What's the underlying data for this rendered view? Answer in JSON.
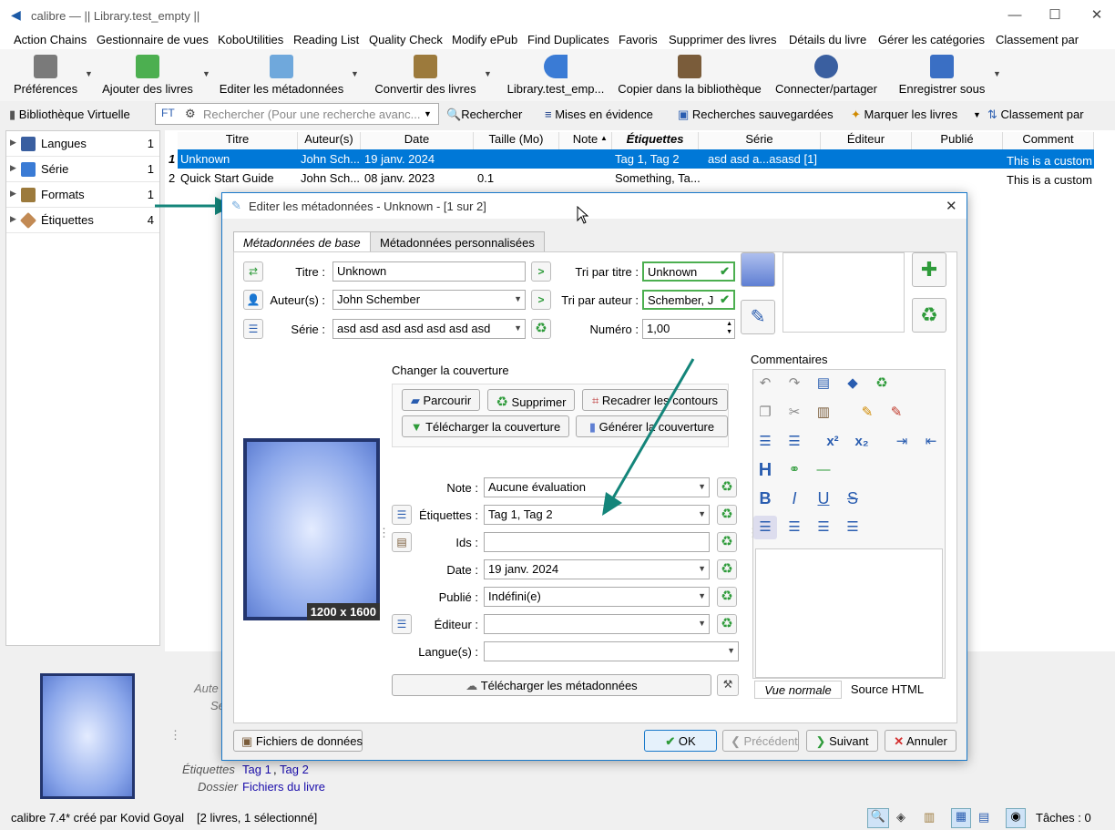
{
  "window": {
    "title": "calibre — || Library.test_empty ||"
  },
  "menu": [
    "Action Chains",
    "Gestionnaire de vues",
    "KoboUtilities",
    "Reading List",
    "Quality Check",
    "Modify ePub",
    "Find Duplicates",
    "Favoris",
    "Supprimer des livres",
    "Détails du livre",
    "Gérer les catégories",
    "Classement par"
  ],
  "toolbar": {
    "prefs": "Préférences",
    "add": "Ajouter des livres",
    "edit": "Editer les métadonnées",
    "convert": "Convertir des livres",
    "library": "Library.test_emp...",
    "copy": "Copier dans la bibliothèque",
    "connect": "Connecter/partager",
    "save": "Enregistrer sous"
  },
  "searchbar": {
    "virtual": "Bibliothèque Virtuelle",
    "placeholder": "Rechercher (Pour une recherche avanc...",
    "search": "Rechercher",
    "highlight": "Mises en évidence",
    "saved": "Recherches sauvegardées",
    "mark": "Marquer les livres",
    "sort": "Classement par"
  },
  "tagbrowser": [
    {
      "name": "Langues",
      "count": "1"
    },
    {
      "name": "Série",
      "count": "1"
    },
    {
      "name": "Formats",
      "count": "1"
    },
    {
      "name": "Étiquettes",
      "count": "4"
    }
  ],
  "columns": [
    "Titre",
    "Auteur(s)",
    "Date",
    "Taille (Mo)",
    "Note",
    "Étiquettes",
    "Série",
    "Éditeur",
    "Publié",
    "Comment"
  ],
  "books": [
    {
      "n": "1",
      "title": "Unknown",
      "author": "John Sch...",
      "date": "19 janv. 2024",
      "size": "",
      "tags": "Tag 1, Tag 2",
      "series": "asd asd a...asasd [1]",
      "comment": "This is a custom"
    },
    {
      "n": "2",
      "title": "Quick Start Guide",
      "author": "John Sch...",
      "date": "08 janv. 2023",
      "size": "0.1",
      "tags": "Something, Ta...",
      "series": "",
      "comment": "This is a custom"
    }
  ],
  "details": {
    "author_lbl": "Aute",
    "series_lbl": "Sé",
    "tags_lbl": "Étiquettes",
    "tags_val1": "Tag 1",
    "tags_sep": ",",
    "tags_val2": "Tag 2",
    "folder_lbl": "Dossier",
    "folder_val": "Fichiers du livre"
  },
  "status": {
    "left": "calibre 7.4* créé par Kovid Goyal",
    "mid": "[2 livres, 1 sélectionné]",
    "tasks": "Tâches : 0"
  },
  "dialog": {
    "title": "Editer les métadonnées - Unknown -  [1 sur 2]",
    "tabs": [
      "Métadonnées de base",
      "Métadonnées personnalisées"
    ],
    "title_lbl": "Titre :",
    "title_val": "Unknown",
    "author_lbl": "Auteur(s) :",
    "author_val": "John Schember",
    "series_lbl": "Série :",
    "series_val": "asd asd asd asd asd asd asd",
    "title_sort_lbl": "Tri par titre :",
    "title_sort_val": "Unknown",
    "author_sort_lbl": "Tri par auteur :",
    "author_sort_val": "Schember, J",
    "number_lbl": "Numéro :",
    "number_val": "1,00",
    "cover_change": "Changer la couverture",
    "browse": "Parcourir",
    "remove": "Supprimer",
    "trim": "Recadrer les contours",
    "download_cover": "Télécharger la couverture",
    "generate_cover": "Générer la couverture",
    "cover_size": "1200 x 1600",
    "rating_lbl": "Note :",
    "rating_val": "Aucune évaluation",
    "tags_lbl": "Étiquettes :",
    "tags_val": "Tag 1, Tag 2",
    "ids_lbl": "Ids :",
    "ids_val": "",
    "date_lbl": "Date :",
    "date_val": "19 janv. 2024",
    "pub_lbl": "Publié :",
    "pub_val": "Indéfini(e)",
    "publisher_lbl": "Éditeur :",
    "publisher_val": "",
    "lang_lbl": "Langue(s) :",
    "lang_val": "",
    "download_meta": "Télécharger les métadonnées",
    "comments_lbl": "Commentaires",
    "view_normal": "Vue normale",
    "view_html": "Source HTML",
    "data_files": "Fichiers de données",
    "ok": "OK",
    "prev": "Précédent",
    "next": "Suivant",
    "cancel": "Annuler"
  },
  "colors": {
    "accent": "#0078d7",
    "selected_row": "#0078d7",
    "link": "#1a0dab",
    "green": "#2e9b3a"
  }
}
